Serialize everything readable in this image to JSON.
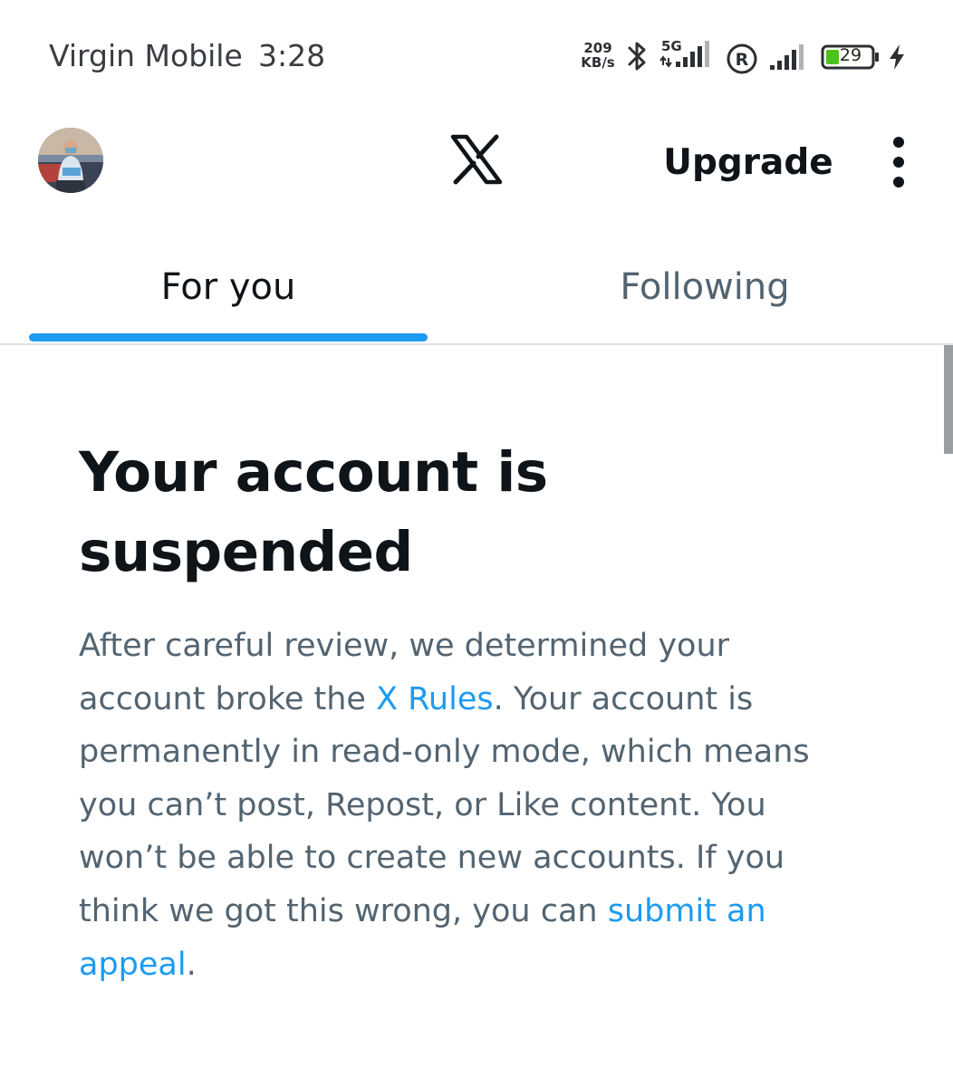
{
  "status_bar": {
    "carrier": "Virgin Mobile",
    "time": "3:28",
    "net_speed_value": "209",
    "net_speed_unit": "KB/s",
    "network_type": "5G",
    "battery_percent": "29",
    "icons": [
      "bluetooth-icon",
      "signal-5g-icon",
      "roaming-icon",
      "signal-icon",
      "battery-icon",
      "charging-icon"
    ]
  },
  "header": {
    "logo": "x-logo-icon",
    "upgrade_label": "Upgrade",
    "more_icon": "more-vertical-icon"
  },
  "tabs": [
    {
      "label": "For you",
      "selected": true
    },
    {
      "label": "Following",
      "selected": false
    }
  ],
  "notice": {
    "title": "Your account is suspended",
    "body_part1": "After careful review, we determined your account broke the ",
    "rules_link": "X Rules",
    "body_part2": ". Your account is permanently in read-only mode, which means you can’t post, Repost, or Like content. You won’t be able to create new accounts. If you think we got this wrong, you can ",
    "appeal_link": "submit an appeal",
    "body_part3": "."
  },
  "colors": {
    "accent": "#1d9bf0",
    "text_primary": "#0f1419",
    "text_secondary": "#536471",
    "divider": "#e1e4e8",
    "battery_fill": "#4cc417"
  }
}
